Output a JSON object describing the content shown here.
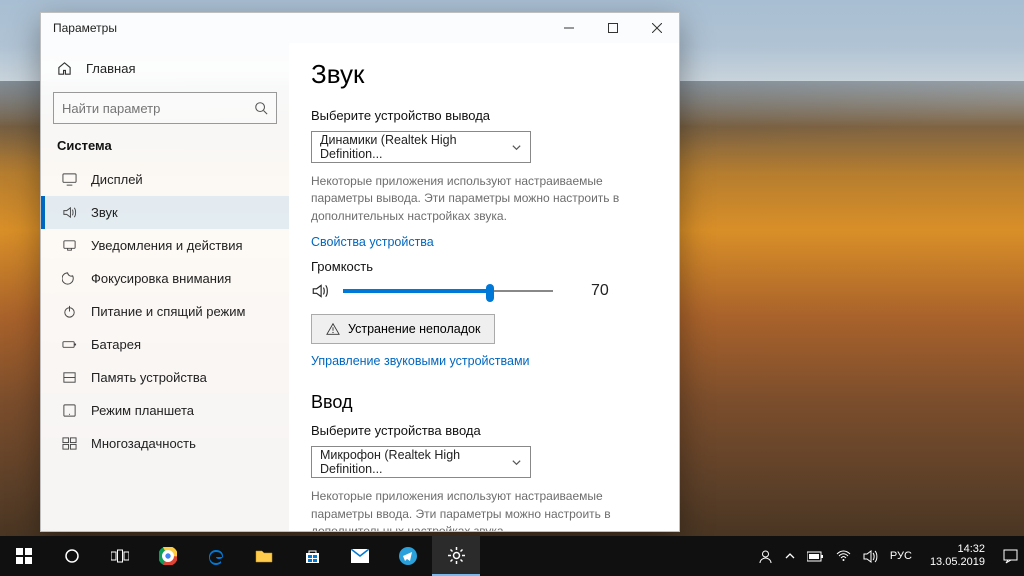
{
  "window": {
    "title": "Параметры"
  },
  "sidebar": {
    "home": "Главная",
    "search_placeholder": "Найти параметр",
    "section": "Система",
    "items": [
      {
        "label": "Дисплей"
      },
      {
        "label": "Звук"
      },
      {
        "label": "Уведомления и действия"
      },
      {
        "label": "Фокусировка внимания"
      },
      {
        "label": "Питание и спящий режим"
      },
      {
        "label": "Батарея"
      },
      {
        "label": "Память устройства"
      },
      {
        "label": "Режим планшета"
      },
      {
        "label": "Многозадачность"
      }
    ]
  },
  "main": {
    "title": "Звук",
    "output_label": "Выберите устройство вывода",
    "output_selected": "Динамики (Realtek High Definition...",
    "output_desc": "Некоторые приложения используют настраиваемые параметры вывода. Эти параметры можно настроить в дополнительных настройках звука.",
    "device_props": "Свойства устройства",
    "volume_label": "Громкость",
    "volume_value": "70",
    "troubleshoot": "Устранение неполадок",
    "manage_devices": "Управление звуковыми устройствами",
    "input_title": "Ввод",
    "input_label": "Выберите устройства ввода",
    "input_selected": "Микрофон (Realtek High Definition...",
    "input_desc": "Некоторые приложения используют настраиваемые параметры ввода. Эти параметры можно настроить в дополнительных настройках звука."
  },
  "taskbar": {
    "lang": "РУС",
    "time": "14:32",
    "date": "13.05.2019"
  }
}
